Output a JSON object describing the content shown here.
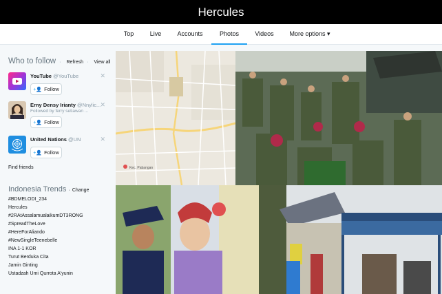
{
  "header": {
    "title": "Hercules"
  },
  "tabs": [
    {
      "label": "Top"
    },
    {
      "label": "Live"
    },
    {
      "label": "Accounts"
    },
    {
      "label": "Photos"
    },
    {
      "label": "Videos"
    },
    {
      "label": "More options ▾"
    }
  ],
  "active_tab": "Photos",
  "who_to_follow": {
    "title": "Who to follow",
    "sep": "·",
    "refresh": "Refresh",
    "view_all": "View all",
    "accounts": [
      {
        "name": "YouTube",
        "handle": "@YouTube",
        "subtext": "",
        "follow_label": "Follow"
      },
      {
        "name": "Erny Densy Irianty",
        "handle": "@Nnylic...",
        "subtext": "Followed by ferry setiawan ...",
        "follow_label": "Follow"
      },
      {
        "name": "United Nations",
        "handle": "@UN",
        "subtext": "",
        "follow_label": "Follow"
      }
    ],
    "find_friends": "Find friends"
  },
  "trends": {
    "title": "Indonesia Trends",
    "sep": "·",
    "change": "Change",
    "items": [
      "#BDMELODI_234",
      "Hercules",
      "#2RAtAssalamualaikumDT3RONG",
      "#SpreadTheLove",
      "#HereForAliando",
      "#NewSingleTeenebelle",
      "INA 1-1 KOR",
      "Turut Berduka Cita",
      "Jamin Ginting",
      "Ustadzah Umi Qurrota A'yunin"
    ]
  },
  "colors": {
    "accent": "#1da1f2",
    "topbar": "#000000"
  },
  "map_text": "Kec. Pabangan"
}
